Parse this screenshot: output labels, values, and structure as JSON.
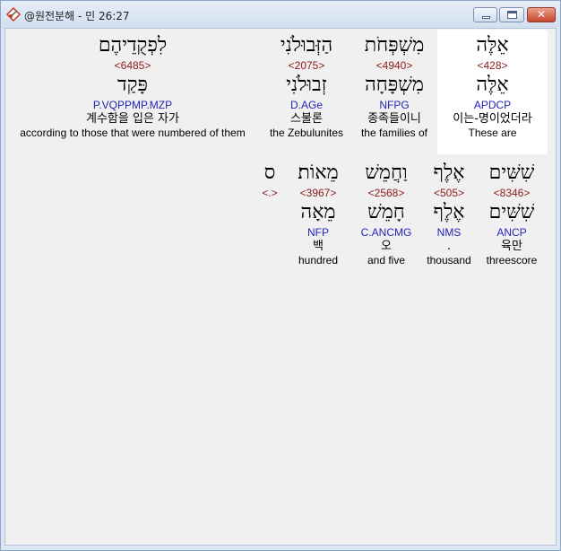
{
  "window": {
    "title": "@원전분해 - 민 26:27",
    "close_glyph": "✕"
  },
  "row1": [
    {
      "hebrew": "לִפְקֻדֵיהֶם",
      "strong": "<6485>",
      "lemma": "פָּקַד",
      "morph": "P.VQPPMP.MZP",
      "korean": "계수함을 입은 자가",
      "english": "according to those that were numbered of them"
    },
    {
      "hebrew": "הַזְּבוּלֹנִי",
      "strong": "<2075>",
      "lemma": "זְבוּלֹנִי",
      "morph": "D.AGe",
      "korean": "스불론",
      "english": "the Zebulunites"
    },
    {
      "hebrew": "מִשְׁפְּחֹת",
      "strong": "<4940>",
      "lemma": "מִשְׁפָּחָה",
      "morph": "NFPG",
      "korean": "종족들이니",
      "english": "the families of"
    },
    {
      "hebrew": "אֵלֶּה",
      "strong": "<428>",
      "lemma": "אֵלֶּה",
      "morph": "APDCP",
      "korean": "이는-명이었더라",
      "english": "These are"
    }
  ],
  "row2": [
    {
      "hebrew": "ס",
      "strong": "<.>",
      "lemma": "",
      "morph": "",
      "korean": "",
      "english": ""
    },
    {
      "hebrew": "מֵאוֹת׃",
      "strong": "<3967>",
      "lemma": "מֵאָה",
      "morph": "NFP",
      "korean": "백",
      "english": "hundred"
    },
    {
      "hebrew": "וַחֲמֵשׁ",
      "strong": "<2568>",
      "lemma": "חָמֵשׁ",
      "morph": "C.ANCMG",
      "korean": "오",
      "english": "and five"
    },
    {
      "hebrew": "אֶלֶף",
      "strong": "<505>",
      "lemma": "אֶלֶף",
      "morph": "NMS",
      "korean": ".",
      "english": "thousand"
    },
    {
      "hebrew": "שִׁשִּׁים",
      "strong": "<8346>",
      "lemma": "שִׁשִּׁים",
      "morph": "ANCP",
      "korean": "육만",
      "english": "threescore"
    }
  ]
}
